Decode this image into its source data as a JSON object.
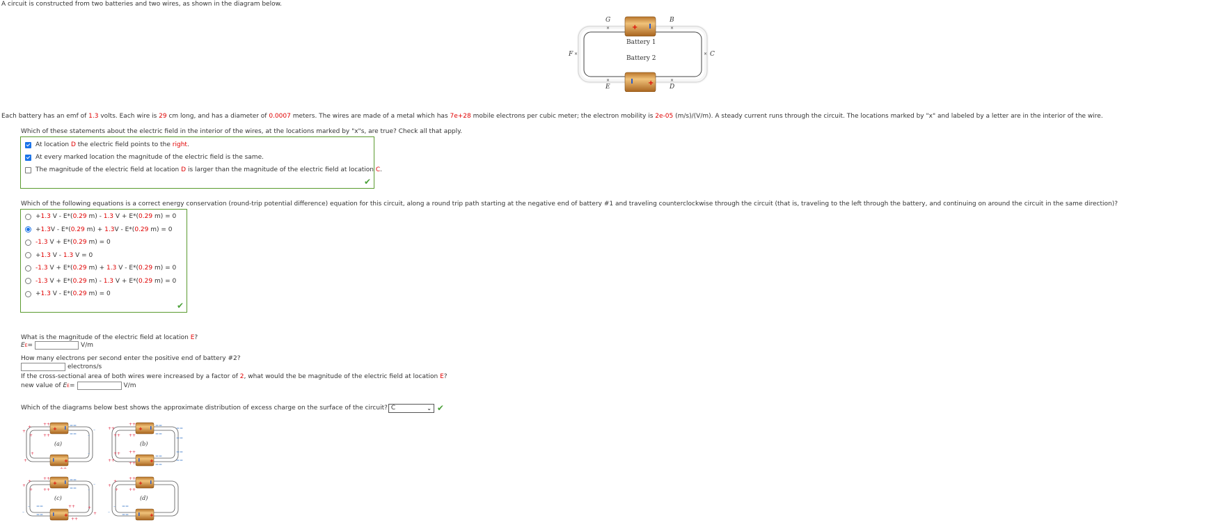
{
  "intro": "A circuit is constructed from two batteries and two wires, as shown in the diagram below.",
  "circuit_diagram": {
    "labels": {
      "G": "G",
      "B": "B",
      "C": "C",
      "D": "D",
      "E": "E",
      "F": "F"
    },
    "battery1": "Battery 1",
    "battery2": "Battery 2",
    "marker": "×",
    "plus": "+",
    "minus": "-"
  },
  "problem": {
    "p1": "Each battery has an emf of ",
    "emf": "1.3",
    "p2": " volts. Each wire is ",
    "length": "29",
    "p3": " cm long, and has a diameter of ",
    "diameter": "0.0007",
    "p4": " meters. The wires are made of a metal which has ",
    "density": "7e+28",
    "p5": " mobile electrons per cubic meter; the electron mobility is ",
    "mobility": "2e-05",
    "p6": " (m/s)/(V/m). A steady current runs through the circuit. The locations marked by \"x\" and labeled by a letter are in the interior of the wire."
  },
  "question1": {
    "prompt": "Which of these statements about the electric field in the interior of the wires, at the locations marked by \"x\"s, are true? Check all that apply.",
    "options": [
      {
        "checked": true,
        "parts": [
          [
            "At location ",
            false
          ],
          [
            "D",
            true
          ],
          [
            " the electric field points to the ",
            false
          ],
          [
            "right",
            true
          ],
          [
            ".",
            false
          ]
        ]
      },
      {
        "checked": true,
        "parts": [
          [
            "At every marked location the magnitude of the electric field is the same.",
            false
          ]
        ]
      },
      {
        "checked": false,
        "parts": [
          [
            "The magnitude of the electric field at location ",
            false
          ],
          [
            "D",
            true
          ],
          [
            " is larger than the magnitude of the electric field at location ",
            false
          ],
          [
            "C",
            true
          ],
          [
            ".",
            false
          ]
        ]
      }
    ],
    "status": "correct"
  },
  "question2": {
    "prompt": "Which of the following equations is a correct energy conservation (round-trip potential difference) equation for this circuit, along a round trip path starting at the negative end of battery #1 and traveling counterclockwise through the circuit (that is, traveling to the left through the battery, and continuing on around the circuit in the same direction)?",
    "options": [
      {
        "selected": false,
        "parts": [
          [
            "+",
            false
          ],
          [
            "1.3",
            true
          ],
          [
            " V - E*(",
            false
          ],
          [
            "0.29",
            true
          ],
          [
            " m) - ",
            false
          ],
          [
            "1.3",
            true
          ],
          [
            " V + E*(",
            false
          ],
          [
            "0.29",
            true
          ],
          [
            " m) = 0",
            false
          ]
        ]
      },
      {
        "selected": true,
        "parts": [
          [
            "+",
            false
          ],
          [
            "1.3",
            true
          ],
          [
            "V - E*(",
            false
          ],
          [
            "0.29",
            true
          ],
          [
            " m) + ",
            false
          ],
          [
            "1.3",
            true
          ],
          [
            "V - E*(",
            false
          ],
          [
            "0.29",
            true
          ],
          [
            " m) = 0",
            false
          ]
        ]
      },
      {
        "selected": false,
        "parts": [
          [
            "-",
            true
          ],
          [
            "1.3",
            true
          ],
          [
            " V + E*(",
            false
          ],
          [
            "0.29",
            true
          ],
          [
            " m) = 0",
            false
          ]
        ]
      },
      {
        "selected": false,
        "parts": [
          [
            "+",
            false
          ],
          [
            "1.3",
            true
          ],
          [
            " V - ",
            false
          ],
          [
            "1.3",
            true
          ],
          [
            " V = 0",
            false
          ]
        ]
      },
      {
        "selected": false,
        "parts": [
          [
            "-",
            true
          ],
          [
            "1.3",
            true
          ],
          [
            " V + E*(",
            false
          ],
          [
            "0.29",
            true
          ],
          [
            " m) + ",
            false
          ],
          [
            "1.3",
            true
          ],
          [
            " V - E*(",
            false
          ],
          [
            "0.29",
            true
          ],
          [
            " m) = 0",
            false
          ]
        ]
      },
      {
        "selected": false,
        "parts": [
          [
            "-",
            true
          ],
          [
            "1.3",
            true
          ],
          [
            " V + E*(",
            false
          ],
          [
            "0.29",
            true
          ],
          [
            " m) - ",
            false
          ],
          [
            "1.3",
            true
          ],
          [
            " V + E*(",
            false
          ],
          [
            "0.29",
            true
          ],
          [
            " m) = 0",
            false
          ]
        ]
      },
      {
        "selected": false,
        "parts": [
          [
            "+",
            false
          ],
          [
            "1.3",
            true
          ],
          [
            " V - E*(",
            false
          ],
          [
            "0.29",
            true
          ],
          [
            " m) = 0",
            false
          ]
        ]
      }
    ],
    "status": "correct"
  },
  "question3": {
    "prompt_a": "What is the magnitude of the electric field at location ",
    "prompt_loc": "E",
    "prompt_b": "?",
    "label_E": "E",
    "label_sub": "E",
    "equals": " =",
    "value": "",
    "unit": "V/m"
  },
  "question4": {
    "prompt": "How many electrons per second enter the positive end of battery #2?",
    "value": "",
    "unit": "electrons/s"
  },
  "question5": {
    "prompt_a": "If the cross-sectional area of both wires were increased by a factor of ",
    "factor": "2",
    "prompt_b": ", what would the be magnitude of the electric field at location ",
    "loc": "E",
    "prompt_c": "?",
    "label_prefix": "new value of ",
    "label_E": "E",
    "label_sub": "E",
    "equals": " =",
    "value": "",
    "unit": "V/m"
  },
  "question6": {
    "prompt": "Which of the diagrams below best shows the approximate distribution of excess charge on the surface of the circuit?",
    "selected": "C",
    "status": "correct",
    "diagrams": [
      {
        "label": "(a)"
      },
      {
        "label": "(b)"
      },
      {
        "label": "(c)"
      },
      {
        "label": "(d)"
      }
    ]
  },
  "colors": {
    "accent_red": "#e00000",
    "correct_green": "#4aa038",
    "box_border": "#5a9a2e",
    "checkbox_blue": "#1a73e8"
  }
}
